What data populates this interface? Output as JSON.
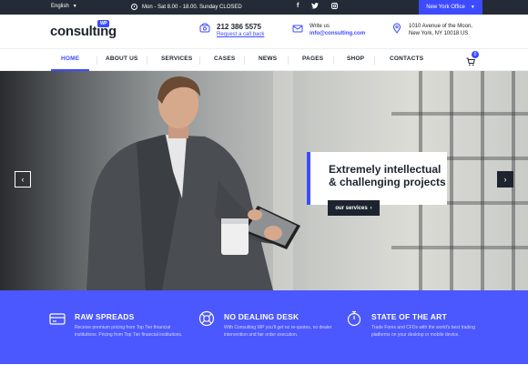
{
  "topbar": {
    "language": "English",
    "hours": "Mon - Sat 8.00 - 18.00. Sunday CLOSED",
    "social_icons": [
      "facebook-icon",
      "twitter-icon",
      "instagram-icon"
    ],
    "office_select": "New York Office"
  },
  "header": {
    "logo": "consulting",
    "logo_badge": "WP",
    "phone": "212 386 5575",
    "phone_link": "Request a call back",
    "write_label": "Write us",
    "email": "info@consulting.com",
    "address_line1": "1010 Avenue of the Moon,",
    "address_line2": "New York, NY 10018 US"
  },
  "nav": {
    "items": [
      "HOME",
      "ABOUT US",
      "SERVICES",
      "CASES",
      "NEWS",
      "PAGES",
      "SHOP",
      "CONTACTS"
    ],
    "active": "HOME",
    "cart_count": "0"
  },
  "hero": {
    "headline_line1": "Extremely intellectual",
    "headline_line2": "& challenging projects",
    "cta_label": "our services",
    "prev_arrow": "‹",
    "next_arrow": "›"
  },
  "features": [
    {
      "icon": "card-icon",
      "title": "RAW SPREADS",
      "desc": "Receive premium pricing from Top Tier financial institutions. Pricing from Top Tier financial institutions."
    },
    {
      "icon": "lifebuoy-icon",
      "title": "NO DEALING DESK",
      "desc": "With Consulting WP you'll get no re-quotes, no dealer intervention and fair order execution."
    },
    {
      "icon": "stopwatch-icon",
      "title": "STATE OF THE ART",
      "desc": "Trade Forex and CFDs with the world's best trading platforms on your desktop or mobile device."
    }
  ],
  "colors": {
    "accent": "#3d4bff",
    "dark": "#1d2430",
    "features_bg": "#4b57ff",
    "topbar_bg": "#242b36"
  }
}
